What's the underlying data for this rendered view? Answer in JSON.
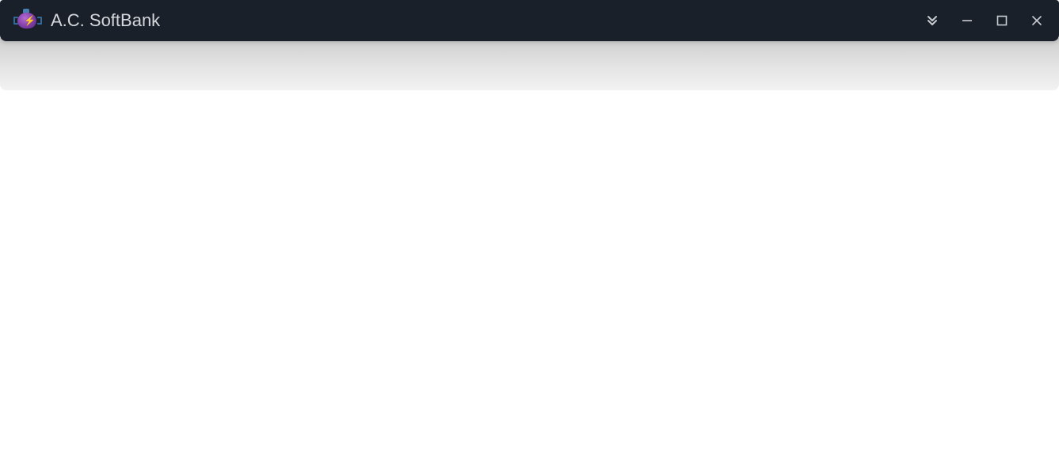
{
  "titlebar": {
    "app_name": "A.C. SoftBank",
    "icon_name": "engine-icon"
  },
  "window_controls": {
    "collapse_label": "Collapse",
    "minimize_label": "Minimize",
    "maximize_label": "Maximize",
    "close_label": "Close"
  },
  "colors": {
    "titlebar_bg": "#1a2029",
    "title_text": "#d4d8dc",
    "control_icon": "#c9cdd2",
    "toolbar_gradient_top": "#cfcfcf",
    "toolbar_gradient_bottom": "#f2f2f2",
    "content_bg": "#ffffff",
    "icon_primary": "#7a3aa0",
    "icon_accent": "#f5c23a"
  }
}
